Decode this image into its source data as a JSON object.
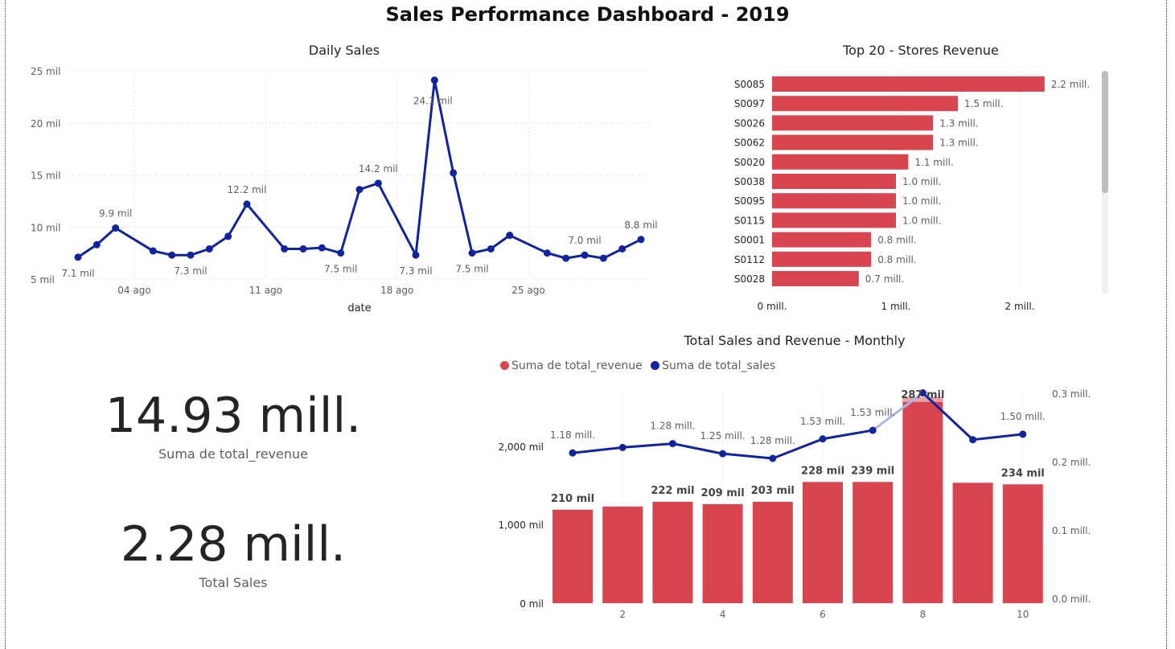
{
  "dashboard": {
    "title": "Sales Performance Dashboard - 2019"
  },
  "colors": {
    "revenue": "#d64550",
    "sales": "#12239e",
    "line_highlight": "#aab5e6"
  },
  "daily_sales": {
    "title": "Daily Sales",
    "xlabel": "date",
    "y_ticks": [
      "5 mil",
      "10 mil",
      "15 mil",
      "20 mil",
      "25 mil"
    ],
    "x_ticks": [
      "04 ago",
      "11 ago",
      "18 ago",
      "25 ago"
    ]
  },
  "stores": {
    "title": "Top 20 - Stores Revenue",
    "x_ticks": [
      "0 mill.",
      "1 mill.",
      "2 mill."
    ]
  },
  "monthly": {
    "title": "Total Sales and Revenue - Monthly",
    "legend": [
      "Suma de total_revenue",
      "Suma de total_sales"
    ],
    "left_ticks": [
      "0 mil",
      "1,000 mil",
      "2,000 mil"
    ],
    "right_ticks": [
      "0.0 mill.",
      "0.1 mill.",
      "0.2 mill.",
      "0.3 mill."
    ],
    "x_ticks": [
      "2",
      "4",
      "6",
      "8",
      "10"
    ]
  },
  "kpis": [
    {
      "value": "14.93 mill.",
      "label": "Suma de total_revenue"
    },
    {
      "value": "2.28 mill.",
      "label": "Total Sales"
    }
  ],
  "chart_data": [
    {
      "type": "line",
      "title": "Daily Sales",
      "xlabel": "date",
      "ylabel": "",
      "x": [
        "2019-08-01",
        "2019-08-02",
        "2019-08-03",
        "2019-08-05",
        "2019-08-06",
        "2019-08-07",
        "2019-08-08",
        "2019-08-09",
        "2019-08-10",
        "2019-08-12",
        "2019-08-13",
        "2019-08-14",
        "2019-08-15",
        "2019-08-16",
        "2019-08-17",
        "2019-08-19",
        "2019-08-20",
        "2019-08-21",
        "2019-08-22",
        "2019-08-23",
        "2019-08-24",
        "2019-08-26",
        "2019-08-27",
        "2019-08-28",
        "2019-08-29",
        "2019-08-30",
        "2019-08-31"
      ],
      "series": [
        {
          "values": [
            7.1,
            8.3,
            9.9,
            7.7,
            7.3,
            7.3,
            7.9,
            9.1,
            12.2,
            7.9,
            7.9,
            8.0,
            7.5,
            13.6,
            14.2,
            7.3,
            24.1,
            15.2,
            7.5,
            7.9,
            9.2,
            7.5,
            7.0,
            7.3,
            7.0,
            7.9,
            8.8
          ]
        }
      ],
      "data_labels": [
        {
          "index": 0,
          "text": "7.1 mil",
          "pos": "below"
        },
        {
          "index": 2,
          "text": "9.9 mil",
          "pos": "above"
        },
        {
          "index": 5,
          "text": "7.3 mil",
          "pos": "below"
        },
        {
          "index": 8,
          "text": "12.2 mil",
          "pos": "above"
        },
        {
          "index": 12,
          "text": "7.5 mil",
          "pos": "below"
        },
        {
          "index": 14,
          "text": "14.2 mil",
          "pos": "above"
        },
        {
          "index": 15,
          "text": "7.3 mil",
          "pos": "below"
        },
        {
          "index": 16,
          "text": "24.1 mil",
          "pos": "below-left"
        },
        {
          "index": 18,
          "text": "7.5 mil",
          "pos": "below"
        },
        {
          "index": 23,
          "text": "7.0 mil",
          "pos": "above"
        },
        {
          "index": 26,
          "text": "8.8 mil",
          "pos": "above"
        }
      ],
      "ylim": [
        5,
        25
      ],
      "grid": true
    },
    {
      "type": "bar",
      "orientation": "horizontal",
      "title": "Top 20 - Stores Revenue",
      "categories": [
        "S0085",
        "S0097",
        "S0026",
        "S0062",
        "S0020",
        "S0038",
        "S0095",
        "S0115",
        "S0001",
        "S0112",
        "S0028"
      ],
      "values": [
        2.2,
        1.5,
        1.3,
        1.3,
        1.1,
        1.0,
        1.0,
        1.0,
        0.8,
        0.8,
        0.7
      ],
      "labels": [
        "2.2 mill.",
        "1.5 mill.",
        "1.3 mill.",
        "1.3 mill.",
        "1.1 mill.",
        "1.0 mill.",
        "1.0 mill.",
        "1.0 mill.",
        "0.8 mill.",
        "0.8 mill.",
        "0.7 mill."
      ],
      "xlim": [
        0,
        2.4
      ],
      "grid": true
    },
    {
      "type": "bar",
      "title": "Total Sales and Revenue - Monthly",
      "categories": [
        1,
        2,
        3,
        4,
        5,
        6,
        7,
        8,
        9,
        10
      ],
      "series": [
        {
          "name": "Suma de total_revenue",
          "type": "bar",
          "axis": "right",
          "values": [
            1.18,
            1.22,
            1.28,
            1.25,
            1.28,
            1.53,
            1.53,
            2.6,
            1.52,
            1.5
          ],
          "labels": [
            "1.18 mill.",
            "",
            "1.28 mill.",
            "1.25 mill.",
            "1.28 mill.",
            "1.53 mill.",
            "1.53 mill.",
            "",
            "",
            "1.50 mill."
          ]
        },
        {
          "name": "Suma de total_sales",
          "type": "line",
          "axis": "left",
          "values": [
            210,
            217,
            222,
            209,
            203,
            228,
            239,
            287,
            227,
            234
          ],
          "labels": [
            "210 mil",
            "",
            "222 mil",
            "209 mil",
            "203 mil",
            "228 mil",
            "239 mil",
            "287 mil",
            "",
            "234 mil"
          ]
        }
      ],
      "right_scale": "bars: values in mill. shown by height",
      "grid": true
    }
  ]
}
